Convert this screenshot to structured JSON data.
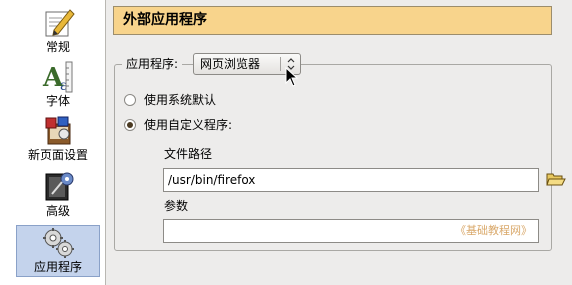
{
  "sidebar": {
    "items": [
      {
        "label": "常规",
        "icon": "pencil-paper-icon",
        "selected": false
      },
      {
        "label": "字体",
        "icon": "font-ruler-icon",
        "selected": false
      },
      {
        "label": "新页面设置",
        "icon": "new-page-icon",
        "selected": false
      },
      {
        "label": "高级",
        "icon": "advanced-gear-icon",
        "selected": false
      },
      {
        "label": "应用程序",
        "icon": "gears-icon",
        "selected": true
      }
    ]
  },
  "header": {
    "title": "外部应用程序"
  },
  "application": {
    "label": "应用程序:",
    "selected_value": "网页浏览器"
  },
  "options": {
    "system_default_label": "使用系统默认",
    "custom_label": "使用自定义程序:",
    "selected": "custom"
  },
  "custom": {
    "path_label": "文件路径",
    "path_value": "/usr/bin/firefox",
    "args_label": "参数",
    "args_value": "",
    "watermark": "《基础教程网》"
  },
  "colors": {
    "header_bg": "#f8d48c",
    "selected_bg": "#c4d3ec"
  }
}
